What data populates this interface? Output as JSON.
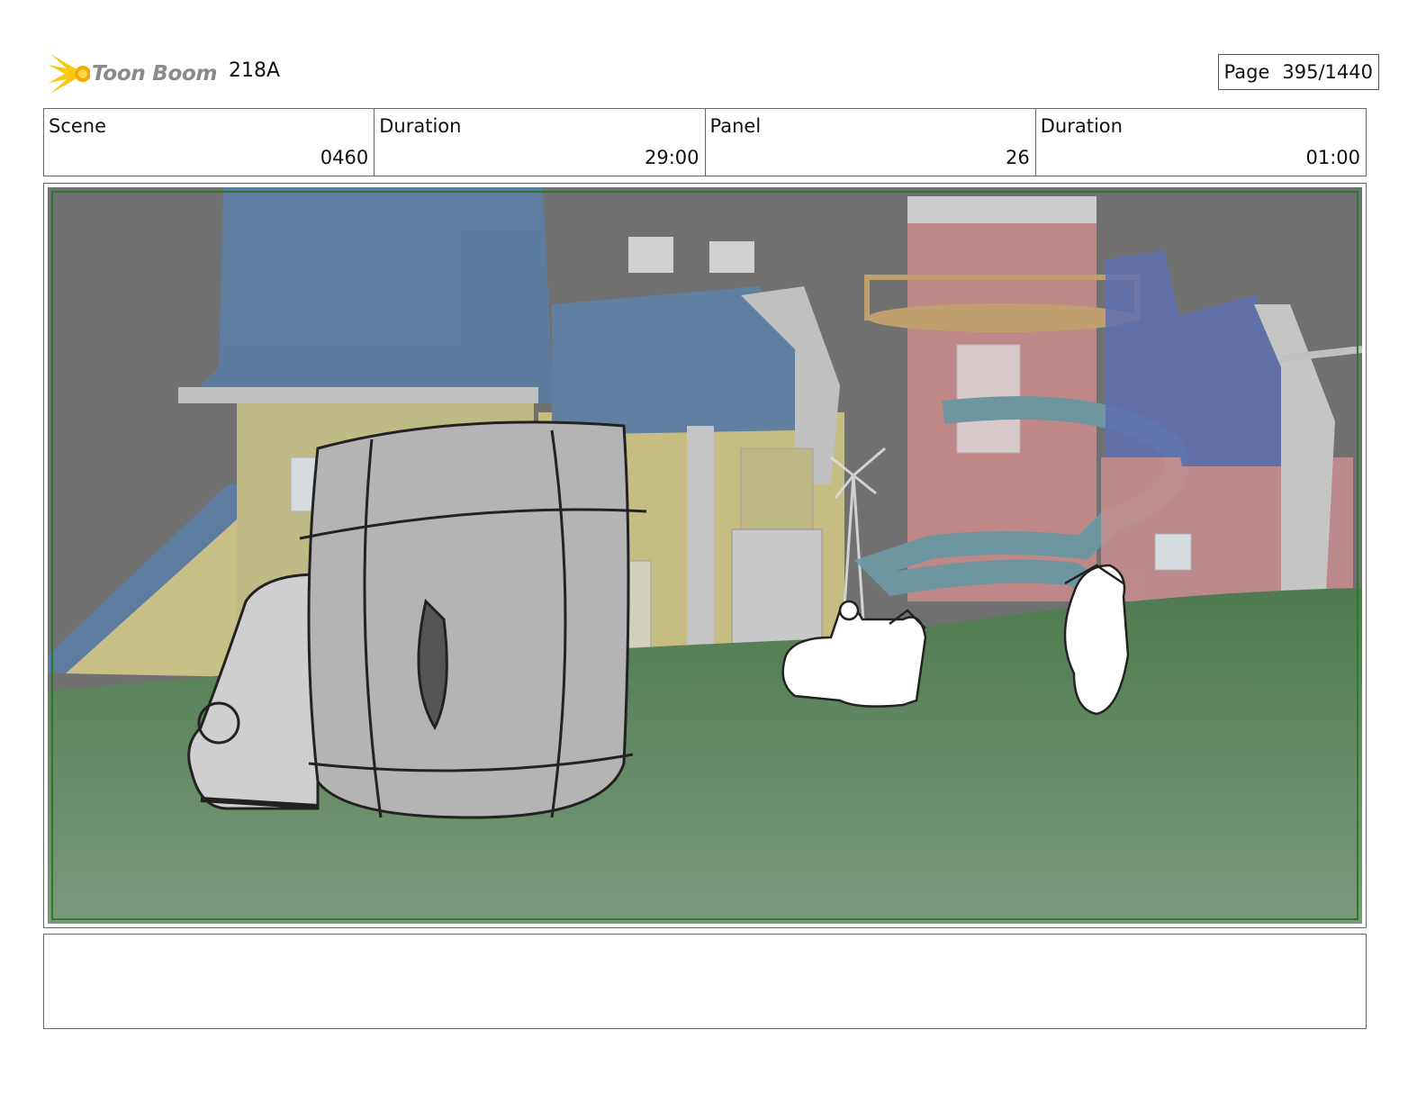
{
  "header": {
    "brand": "Toon Boom",
    "episode": "218A",
    "page_label": "Page",
    "page_value": "395/1440"
  },
  "info": {
    "scene_label": "Scene",
    "scene_value": "0460",
    "scene_duration_label": "Duration",
    "scene_duration_value": "29:00",
    "panel_label": "Panel",
    "panel_value": "26",
    "panel_duration_label": "Duration",
    "panel_duration_value": "01:00"
  },
  "notes": {
    "text": ""
  },
  "colors": {
    "sky": "#707070",
    "grass": "#6f8f74",
    "frame": "#2d7a2d",
    "logo_yellow": "#f6c90e"
  }
}
